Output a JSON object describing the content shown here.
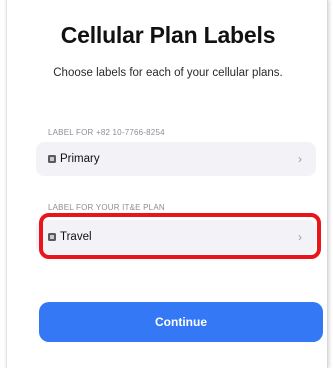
{
  "header": {
    "title": "Cellular Plan Labels",
    "subtitle": "Choose labels for each of your cellular plans."
  },
  "plans": [
    {
      "section_label": "LABEL FOR +82 10-7766-8254",
      "label": "Primary",
      "icon": "sim-card-icon",
      "chevron": "›"
    },
    {
      "section_label": "LABEL FOR YOUR IT&E PLAN",
      "label": "Travel",
      "icon": "sim-card-icon",
      "chevron": "›",
      "highlighted": true
    }
  ],
  "footer": {
    "continue_label": "Continue"
  },
  "colors": {
    "accent": "#3478f6",
    "highlight": "#e8151b",
    "row_bg": "#f2f2f7"
  }
}
